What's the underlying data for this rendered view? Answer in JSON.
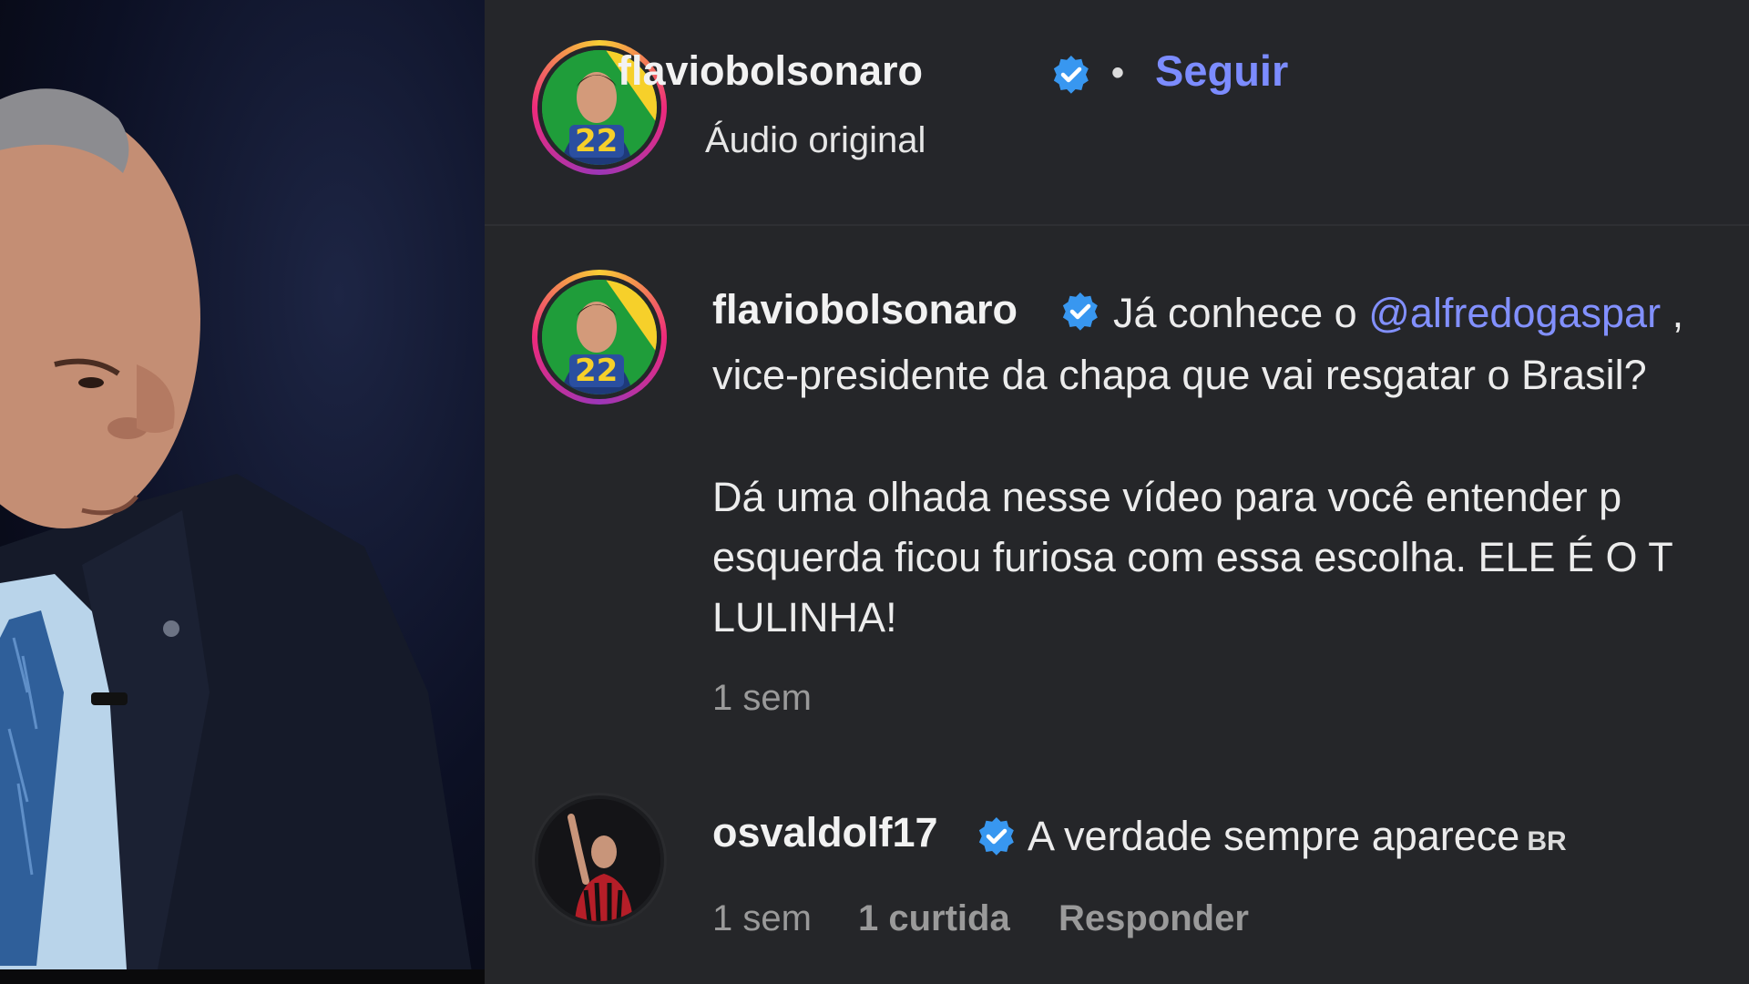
{
  "header": {
    "username": "flaviobolsonaro",
    "dot": "•",
    "follow_label": "Seguir",
    "audio_label": "Áudio original",
    "avatar_badge": "22"
  },
  "post": {
    "username": "flaviobolsonaro",
    "caption_prefix": "Já conhece o ",
    "mention": "@alfredogaspar",
    "caption_line1_tail": " ,",
    "caption_line2": "vice-presidente da chapa que vai resgatar o Brasil?",
    "caption_line3": "Dá uma olhada nesse vídeo para você entender p",
    "caption_line4": "esquerda ficou furiosa com essa escolha. ELE É O T",
    "caption_line5": "LULINHA!",
    "time": "1 sem",
    "avatar_badge": "22"
  },
  "comment": {
    "username": "osvaldolf17",
    "text": "A verdade sempre aparece",
    "flag": "BR",
    "time": "1 sem",
    "likes": "1 curtida",
    "reply_label": "Responder"
  },
  "colors": {
    "link": "#7c8cff",
    "verified": "#3897f0",
    "background": "#252629"
  }
}
